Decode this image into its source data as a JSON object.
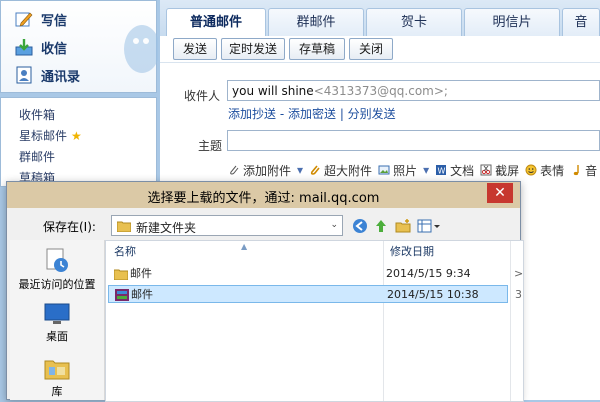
{
  "sidebar": {
    "primary": [
      {
        "label": "写信",
        "icon": "pencil-icon"
      },
      {
        "label": "收信",
        "icon": "inbox-download-icon"
      },
      {
        "label": "通讯录",
        "icon": "contacts-book-icon"
      }
    ],
    "folders": [
      "收件箱",
      "星标邮件",
      "群邮件",
      "草稿箱"
    ],
    "star_glyph": "★"
  },
  "compose": {
    "tabs": [
      "普通邮件",
      "群邮件",
      "贺卡",
      "明信片",
      "音"
    ],
    "active_tab": "普通邮件",
    "actions": [
      "发送",
      "定时发送",
      "存草稿",
      "关闭"
    ],
    "to_label": "收件人",
    "to_name": "you will shine",
    "to_addr": "<4313373@qq.com>;",
    "cc_links": [
      "添加抄送",
      "添加密送",
      "分别发送"
    ],
    "link_sep": " - ",
    "link_sep2": " | ",
    "subject_label": "主题",
    "subject_value": "",
    "attach_items": [
      "添加附件",
      "超大附件",
      "照片",
      "文档",
      "截屏",
      "表情",
      "音"
    ],
    "dropdown_glyph": "▾"
  },
  "dialog": {
    "title": "选择要上载的文件，通过: mail.qq.com",
    "close_glyph": "✕",
    "save_in_label": "保存在(I):",
    "folder": "新建文件夹",
    "combo_arrow": "⌄",
    "places": [
      "最近访问的位置",
      "桌面",
      "库"
    ],
    "columns": [
      "名称",
      "修改日期"
    ],
    "sort_glyph": "▲",
    "rows": [
      {
        "name": "邮件",
        "date": "2014/5/15 9:34",
        "kind": "folder",
        "selected": false
      },
      {
        "name": "邮件",
        "date": "2014/5/15 10:38",
        "kind": "archive",
        "selected": true
      }
    ],
    "cut_glyphs": [
      "​",
      ">",
      "3"
    ]
  },
  "colors": {
    "accent": "#1d4e9e",
    "selection": "#cde8ff",
    "title_bar": "#dbc9a6",
    "close": "#c7372f"
  }
}
